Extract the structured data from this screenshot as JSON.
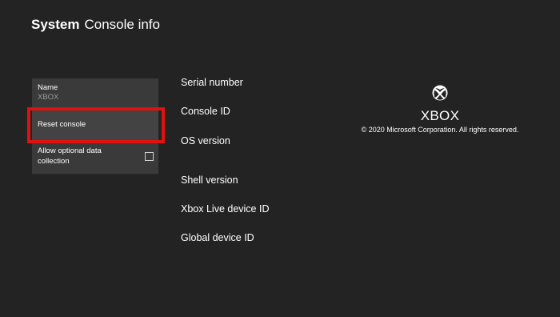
{
  "header": {
    "section": "System",
    "page": "Console info"
  },
  "menu": {
    "name_label": "Name",
    "name_value": "XBOX",
    "reset_label": "Reset console",
    "optional_data_label": "Allow optional data collection",
    "optional_data_checked": false
  },
  "info": {
    "serial_number": "Serial number",
    "console_id": "Console ID",
    "os_version": "OS version",
    "shell_version": "Shell version",
    "xbox_live_device_id": "Xbox Live device ID",
    "global_device_id": "Global device ID"
  },
  "brand": {
    "icon": "xbox-logo-icon",
    "name": "XBOX",
    "copyright": "© 2020 Microsoft Corporation. All rights reserved."
  },
  "colors": {
    "background": "#232323",
    "tile": "#3a3a3a",
    "focus_border": "#e0110e"
  }
}
